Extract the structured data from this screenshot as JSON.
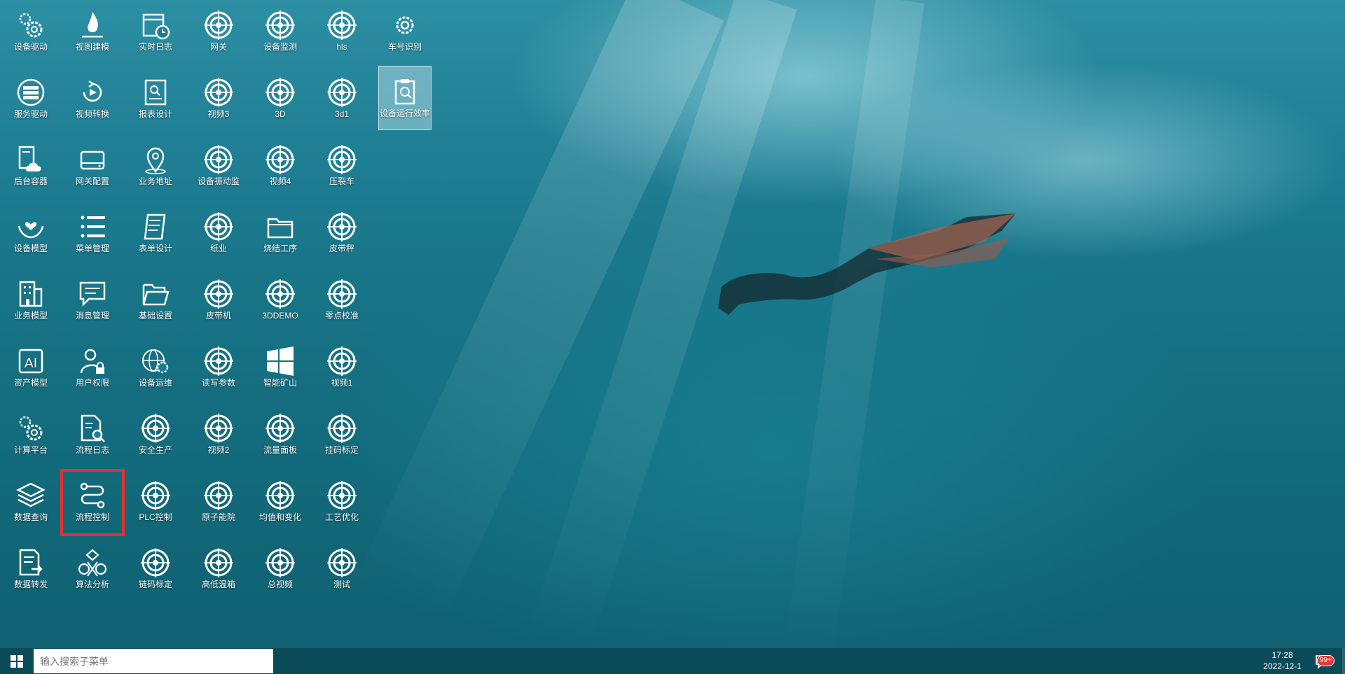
{
  "desktop": {
    "icons": [
      {
        "label": "设备驱动",
        "icon": "gears-icon"
      },
      {
        "label": "视图建模",
        "icon": "flame-icon"
      },
      {
        "label": "实时日志",
        "icon": "calendar-clock-icon"
      },
      {
        "label": "网关",
        "icon": "target-icon"
      },
      {
        "label": "设备监测",
        "icon": "target-icon"
      },
      {
        "label": "hls",
        "icon": "target-icon"
      },
      {
        "label": "车号识别",
        "icon": "gear-icon"
      },
      {
        "label": "服务驱动",
        "icon": "server-icon"
      },
      {
        "label": "视频转换",
        "icon": "video-rotate-icon"
      },
      {
        "label": "报表设计",
        "icon": "report-icon"
      },
      {
        "label": "视频3",
        "icon": "target-icon"
      },
      {
        "label": "3D",
        "icon": "target-icon"
      },
      {
        "label": "3d1",
        "icon": "target-icon"
      },
      {
        "label": "设备运行效率",
        "icon": "clipboard-search-icon"
      },
      {
        "label": "后台容器",
        "icon": "cloud-document-icon"
      },
      {
        "label": "网关配置",
        "icon": "drive-icon"
      },
      {
        "label": "业务地址",
        "icon": "location-pin-icon"
      },
      {
        "label": "设备振动监",
        "icon": "target-icon"
      },
      {
        "label": "视频4",
        "icon": "target-icon"
      },
      {
        "label": "压裂车",
        "icon": "target-icon"
      },
      {
        "label": "设备模型",
        "icon": "hands-heart-icon"
      },
      {
        "label": "菜单管理",
        "icon": "list-icon"
      },
      {
        "label": "表单设计",
        "icon": "form-icon"
      },
      {
        "label": "纸业",
        "icon": "target-icon"
      },
      {
        "label": "烧结工序",
        "icon": "folder-icon"
      },
      {
        "label": "皮带秤",
        "icon": "target-icon"
      },
      {
        "label": "业务模型",
        "icon": "building-icon"
      },
      {
        "label": "消息管理",
        "icon": "message-icon"
      },
      {
        "label": "基础设置",
        "icon": "folder-open-icon"
      },
      {
        "label": "皮带机",
        "icon": "target-icon"
      },
      {
        "label": "3DDEMO",
        "icon": "target-icon"
      },
      {
        "label": "零点校准",
        "icon": "target-icon"
      },
      {
        "label": "资产模型",
        "icon": "ai-icon"
      },
      {
        "label": "用户权限",
        "icon": "user-lock-icon"
      },
      {
        "label": "设备运维",
        "icon": "globe-gear-icon"
      },
      {
        "label": "读写参数",
        "icon": "target-icon"
      },
      {
        "label": "智能矿山",
        "icon": "windows-icon"
      },
      {
        "label": "视频1",
        "icon": "target-icon"
      },
      {
        "label": "计算平台",
        "icon": "gears-icon"
      },
      {
        "label": "流程日志",
        "icon": "document-search-icon"
      },
      {
        "label": "安全生产",
        "icon": "target-icon"
      },
      {
        "label": "视频2",
        "icon": "target-icon"
      },
      {
        "label": "流量面板",
        "icon": "target-icon"
      },
      {
        "label": "挂码标定",
        "icon": "target-icon"
      },
      {
        "label": "数据查询",
        "icon": "layers-icon"
      },
      {
        "label": "流程控制",
        "icon": "flow-route-icon"
      },
      {
        "label": "PLC控制",
        "icon": "target-icon"
      },
      {
        "label": "原子能院",
        "icon": "target-icon"
      },
      {
        "label": "均值和变化",
        "icon": "target-icon"
      },
      {
        "label": "工艺优化",
        "icon": "target-icon"
      },
      {
        "label": "数据转发",
        "icon": "document-forward-icon"
      },
      {
        "label": "算法分析",
        "icon": "algorithm-icon"
      },
      {
        "label": "链码标定",
        "icon": "target-icon"
      },
      {
        "label": "高低温箱",
        "icon": "target-icon"
      },
      {
        "label": "总视频",
        "icon": "target-icon"
      },
      {
        "label": "测试",
        "icon": "target-icon"
      }
    ]
  },
  "taskbar": {
    "search_placeholder": "输入搜索子菜单",
    "time": "17:28",
    "date": "2022-12-1",
    "badge": "99+"
  }
}
